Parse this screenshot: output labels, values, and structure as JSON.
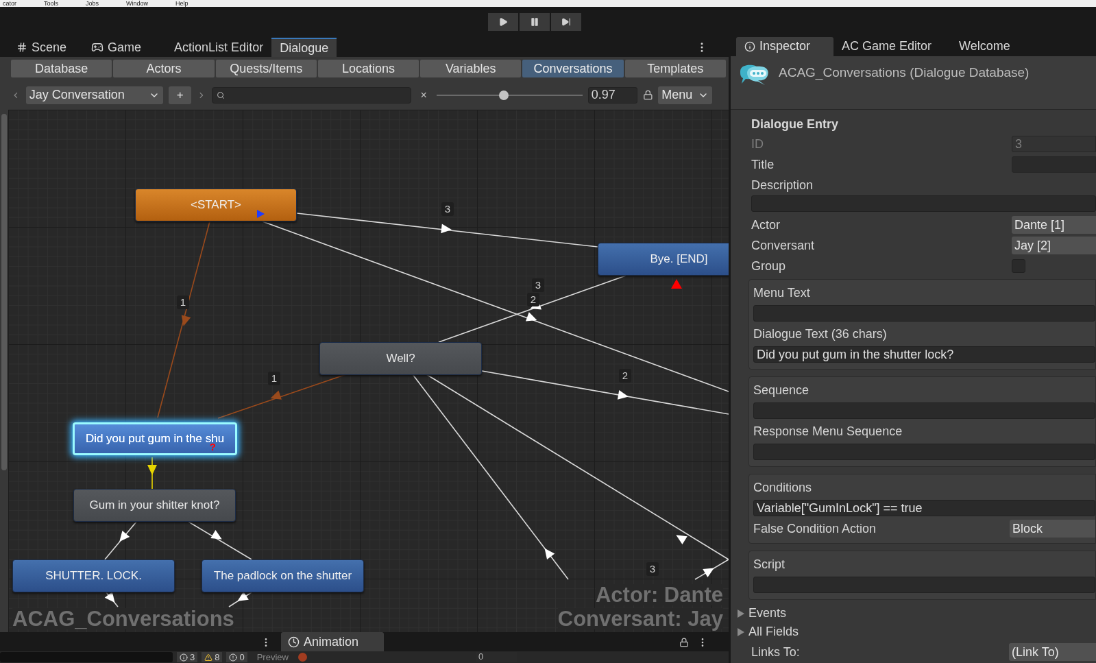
{
  "menu_bar": [
    "cator",
    "Tools",
    "Jobs",
    "Window",
    "Help"
  ],
  "editor_tabs": [
    {
      "label": "Scene",
      "selected": false
    },
    {
      "label": "Game",
      "selected": false
    },
    {
      "label": "ActionList Editor",
      "selected": false
    },
    {
      "label": "Dialogue",
      "selected": true
    }
  ],
  "database_tabs": [
    {
      "label": "Database",
      "selected": false
    },
    {
      "label": "Actors",
      "selected": false
    },
    {
      "label": "Quests/Items",
      "selected": false
    },
    {
      "label": "Locations",
      "selected": false
    },
    {
      "label": "Variables",
      "selected": false
    },
    {
      "label": "Conversations",
      "selected": true
    },
    {
      "label": "Templates",
      "selected": false
    }
  ],
  "toolbar": {
    "conversation": "Jay Conversation",
    "add": "+",
    "clear": "×",
    "zoom": {
      "level": 0.46,
      "reading": "0.97"
    },
    "menu": "Menu"
  },
  "nodes": [
    {
      "text": "<START>",
      "kind": "start",
      "selected": false
    },
    {
      "text": "Bye. [END]",
      "kind": "player",
      "selected": false
    },
    {
      "text": "Well?",
      "kind": "npc",
      "selected": false
    },
    {
      "text": "Did you put gum in the shu",
      "kind": "player",
      "selected": true,
      "marker": "?"
    },
    {
      "text": "Gum in your shitter knot?",
      "kind": "npc",
      "selected": false
    },
    {
      "text": "SHUTTER. LOCK.",
      "kind": "player",
      "selected": false
    },
    {
      "text": "The padlock on the shutter",
      "kind": "player",
      "selected": false
    }
  ],
  "link_numbers": [
    "3",
    "1",
    "1",
    "3",
    "2",
    "2",
    "3"
  ],
  "canvas_overlay": {
    "database": "ACAG_Conversations",
    "actor": "Actor: Dante",
    "conversant": "Conversant: Jay"
  },
  "bottom": {
    "tab": "Animation",
    "console_counts": [
      {
        "kind": "info",
        "count": "3"
      },
      {
        "kind": "warning",
        "count": "8"
      },
      {
        "kind": "error",
        "count": "0"
      }
    ],
    "preview": "Preview",
    "frame": "0"
  },
  "inspector": {
    "tabs": [
      {
        "label": "Inspector",
        "selected": true
      },
      {
        "label": "AC Game Editor",
        "selected": false
      },
      {
        "label": "Welcome",
        "selected": false
      }
    ],
    "title": "ACAG_Conversations (Dialogue Database)",
    "section": "Dialogue Entry",
    "fields": [
      {
        "kind": "text",
        "label": "ID",
        "value": "3",
        "disabled": true
      },
      {
        "kind": "text",
        "label": "Title",
        "disabled": false
      },
      {
        "kind": "wide",
        "label": "Description",
        "disabled": false
      },
      {
        "kind": "dropdown",
        "label": "Actor",
        "value": "Dante [1]",
        "disabled": false
      },
      {
        "kind": "dropdown",
        "label": "Conversant",
        "value": "Jay [2]",
        "disabled": false
      },
      {
        "kind": "checkbox",
        "label": "Group",
        "checked": false,
        "disabled": false
      }
    ],
    "groups": [
      {
        "fields": [
          {
            "kind": "stacked",
            "label": "Menu Text"
          },
          {
            "kind": "stacked",
            "label": "Dialogue Text (36 chars)",
            "value": "Did you put gum in the shutter lock?"
          }
        ]
      },
      {
        "fields": [
          {
            "kind": "stacked",
            "label": "Sequence"
          },
          {
            "kind": "stacked",
            "label": "Response Menu Sequence"
          }
        ]
      },
      {
        "fields": [
          {
            "kind": "stacked",
            "label": "Conditions",
            "value": "Variable[\"GumInLock\"] == true"
          },
          {
            "kind": "dropdown",
            "label": "False Condition Action",
            "value": "Block"
          }
        ]
      },
      {
        "fields": [
          {
            "kind": "stacked",
            "label": "Script"
          }
        ]
      }
    ],
    "foldouts": [
      {
        "label": "Events",
        "expanded": false
      },
      {
        "label": "All Fields",
        "expanded": false
      }
    ],
    "links_to": {
      "label": "Links To:",
      "value": "(Link To)"
    }
  }
}
